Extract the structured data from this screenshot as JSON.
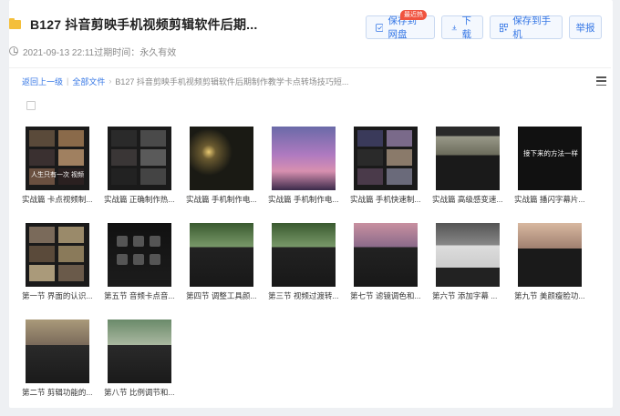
{
  "header": {
    "title": "B127 抖音剪映手机视频剪辑软件后期...",
    "meta_date": "2021-09-13 22:11过期时间：永久有效",
    "colors": {
      "accent": "#3476e5",
      "folder": "#f4bf3a",
      "badge": "#f0533f"
    }
  },
  "actions": {
    "save_to_drive": "保存到网盘",
    "save_badge": "最近热",
    "download": "下载",
    "save_to_phone": "保存到手机",
    "report": "举报"
  },
  "breadcrumb": {
    "back": "返回上一级",
    "all_files": "全部文件",
    "current": "B127 抖音剪映手机视频剪辑软件后期制作教学卡点转场技巧短..."
  },
  "files": [
    {
      "name": "实战篇 卡点视频制...",
      "theme": "grid-warm"
    },
    {
      "name": "实战篇 正确制作热...",
      "theme": "grid-dark"
    },
    {
      "name": "实战篇 手机制作电...",
      "theme": "night-light"
    },
    {
      "name": "实战篇 手机制作电...",
      "theme": "purple-sky"
    },
    {
      "name": "实战篇 手机快速制...",
      "theme": "grid-mixed"
    },
    {
      "name": "实战篇 高级感变速...",
      "theme": "street"
    },
    {
      "name": "实战篇 播闪字幕片...",
      "theme": "text-dark"
    },
    {
      "name": "第一节 界面的认识...",
      "theme": "grid-warm2"
    },
    {
      "name": "第五节 音频卡点音...",
      "theme": "app-dark"
    },
    {
      "name": "第四节 调整工具颜...",
      "theme": "field"
    },
    {
      "name": "第三节 视频过渡转...",
      "theme": "field2"
    },
    {
      "name": "第七节 滤镜调色和...",
      "theme": "pink-app"
    },
    {
      "name": "第六节 添加字幕 ...",
      "theme": "light-app"
    },
    {
      "name": "第九节 美颜瘦脸功...",
      "theme": "face-app"
    },
    {
      "name": "第二节 剪辑功能的...",
      "theme": "room-app"
    },
    {
      "name": "第八节 比例调节和...",
      "theme": "landscape-app"
    }
  ],
  "thumb_captions": {
    "grid_warm": "人生只有一次 视频",
    "text_dark": "接下来的方法一样"
  }
}
